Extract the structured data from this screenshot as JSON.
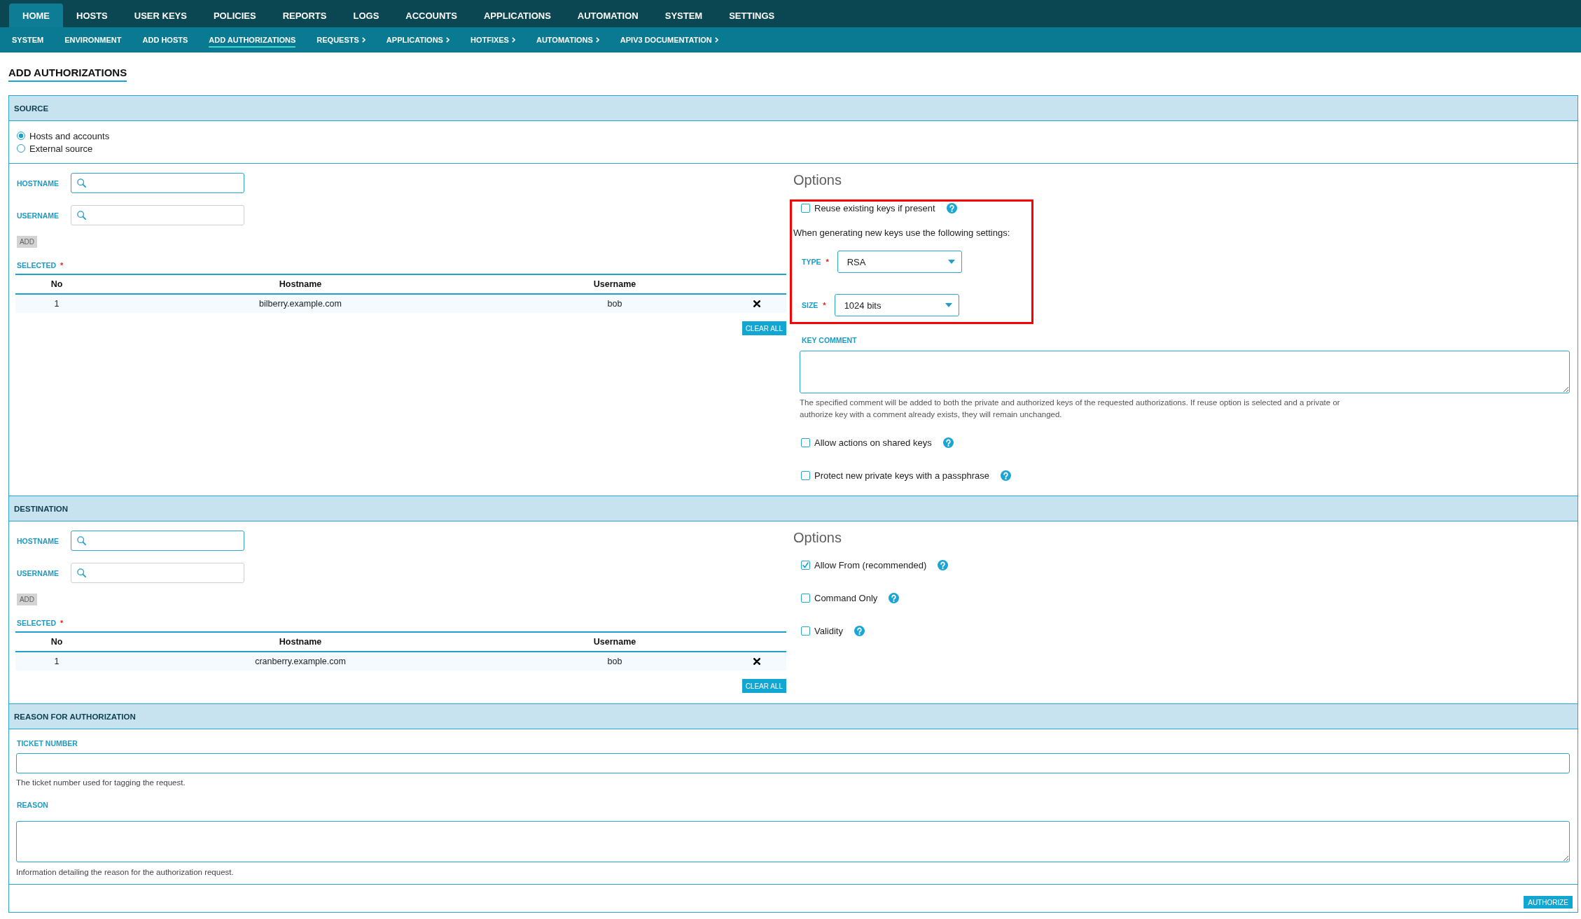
{
  "top_nav": [
    {
      "label": "HOME",
      "selected": true
    },
    {
      "label": "HOSTS",
      "selected": false
    },
    {
      "label": "USER KEYS",
      "selected": false
    },
    {
      "label": "POLICIES",
      "selected": false
    },
    {
      "label": "REPORTS",
      "selected": false
    },
    {
      "label": "LOGS",
      "selected": false
    },
    {
      "label": "ACCOUNTS",
      "selected": false
    },
    {
      "label": "APPLICATIONS",
      "selected": false
    },
    {
      "label": "AUTOMATION",
      "selected": false
    },
    {
      "label": "SYSTEM",
      "selected": false
    },
    {
      "label": "SETTINGS",
      "selected": false
    }
  ],
  "sub_nav": [
    {
      "label": "SYSTEM",
      "selected": false,
      "has_menu": false
    },
    {
      "label": "ENVIRONMENT",
      "selected": false,
      "has_menu": false
    },
    {
      "label": "ADD HOSTS",
      "selected": false,
      "has_menu": false
    },
    {
      "label": "ADD AUTHORIZATIONS",
      "selected": true,
      "has_menu": false
    },
    {
      "label": "REQUESTS",
      "selected": false,
      "has_menu": true
    },
    {
      "label": "APPLICATIONS",
      "selected": false,
      "has_menu": true
    },
    {
      "label": "HOTFIXES",
      "selected": false,
      "has_menu": true
    },
    {
      "label": "AUTOMATIONS",
      "selected": false,
      "has_menu": true
    },
    {
      "label": "APIV3 DOCUMENTATION",
      "selected": false,
      "has_menu": true
    }
  ],
  "page_title": "ADD AUTHORIZATIONS",
  "source": {
    "title": "SOURCE",
    "source_types": [
      {
        "label": "Hosts and accounts",
        "selected": true
      },
      {
        "label": "External source",
        "selected": false
      }
    ],
    "fields": [
      {
        "label": "HOSTNAME",
        "focused": true
      },
      {
        "label": "USERNAME",
        "focused": false
      }
    ],
    "add_button": {
      "label": "ADD",
      "disabled": true
    },
    "selected": {
      "label": "SELECTED",
      "required_mark": "*"
    },
    "table": {
      "columns": [
        "No",
        "Hostname",
        "Username"
      ],
      "rows": [
        {
          "no": "1",
          "hostname": "bilberry.example.com",
          "username": "bob"
        }
      ]
    },
    "clear_button": "CLEAR ALL",
    "options": {
      "title": "Options",
      "key_settings": {
        "highlighted": true,
        "reuse_keys": {
          "label": "Reuse existing keys if present",
          "checked": false
        },
        "note": "When generating new keys use the following settings:",
        "selects": [
          {
            "label": "TYPE",
            "required_mark": "*",
            "value": "RSA"
          },
          {
            "label": "SIZE",
            "required_mark": "*",
            "value": "1024 bits"
          }
        ]
      },
      "key_comment": {
        "label": "KEY COMMENT",
        "help_text": "The specified comment will be added to both the private and authorized keys of the requested authorizations. If reuse option is selected and a private or authorize key with a comment already exists, they will remain unchanged."
      },
      "checkboxes": [
        {
          "label": "Allow actions on shared keys",
          "checked": false
        },
        {
          "label": "Protect new private keys with a passphrase",
          "checked": false
        }
      ]
    }
  },
  "destination": {
    "title": "DESTINATION",
    "fields": [
      {
        "label": "HOSTNAME",
        "focused": true
      },
      {
        "label": "USERNAME",
        "focused": false
      }
    ],
    "add_button": {
      "label": "ADD",
      "disabled": true
    },
    "selected": {
      "label": "SELECTED",
      "required_mark": "*"
    },
    "table": {
      "columns": [
        "No",
        "Hostname",
        "Username"
      ],
      "rows": [
        {
          "no": "1",
          "hostname": "cranberry.example.com",
          "username": "bob"
        }
      ]
    },
    "clear_button": "CLEAR ALL",
    "options": {
      "title": "Options",
      "checkboxes": [
        {
          "label": "Allow From (recommended)",
          "checked": true
        },
        {
          "label": "Command Only",
          "checked": false
        },
        {
          "label": "Validity",
          "checked": false
        }
      ]
    }
  },
  "reason": {
    "title": "REASON FOR AUTHORIZATION",
    "ticket_number": {
      "label": "TICKET NUMBER",
      "help_text": "The ticket number used for tagging the request."
    },
    "reason": {
      "label": "REASON",
      "help_text": "Information detailing the reason for the authorization request."
    }
  },
  "authorize_button": "AUTHORIZE"
}
